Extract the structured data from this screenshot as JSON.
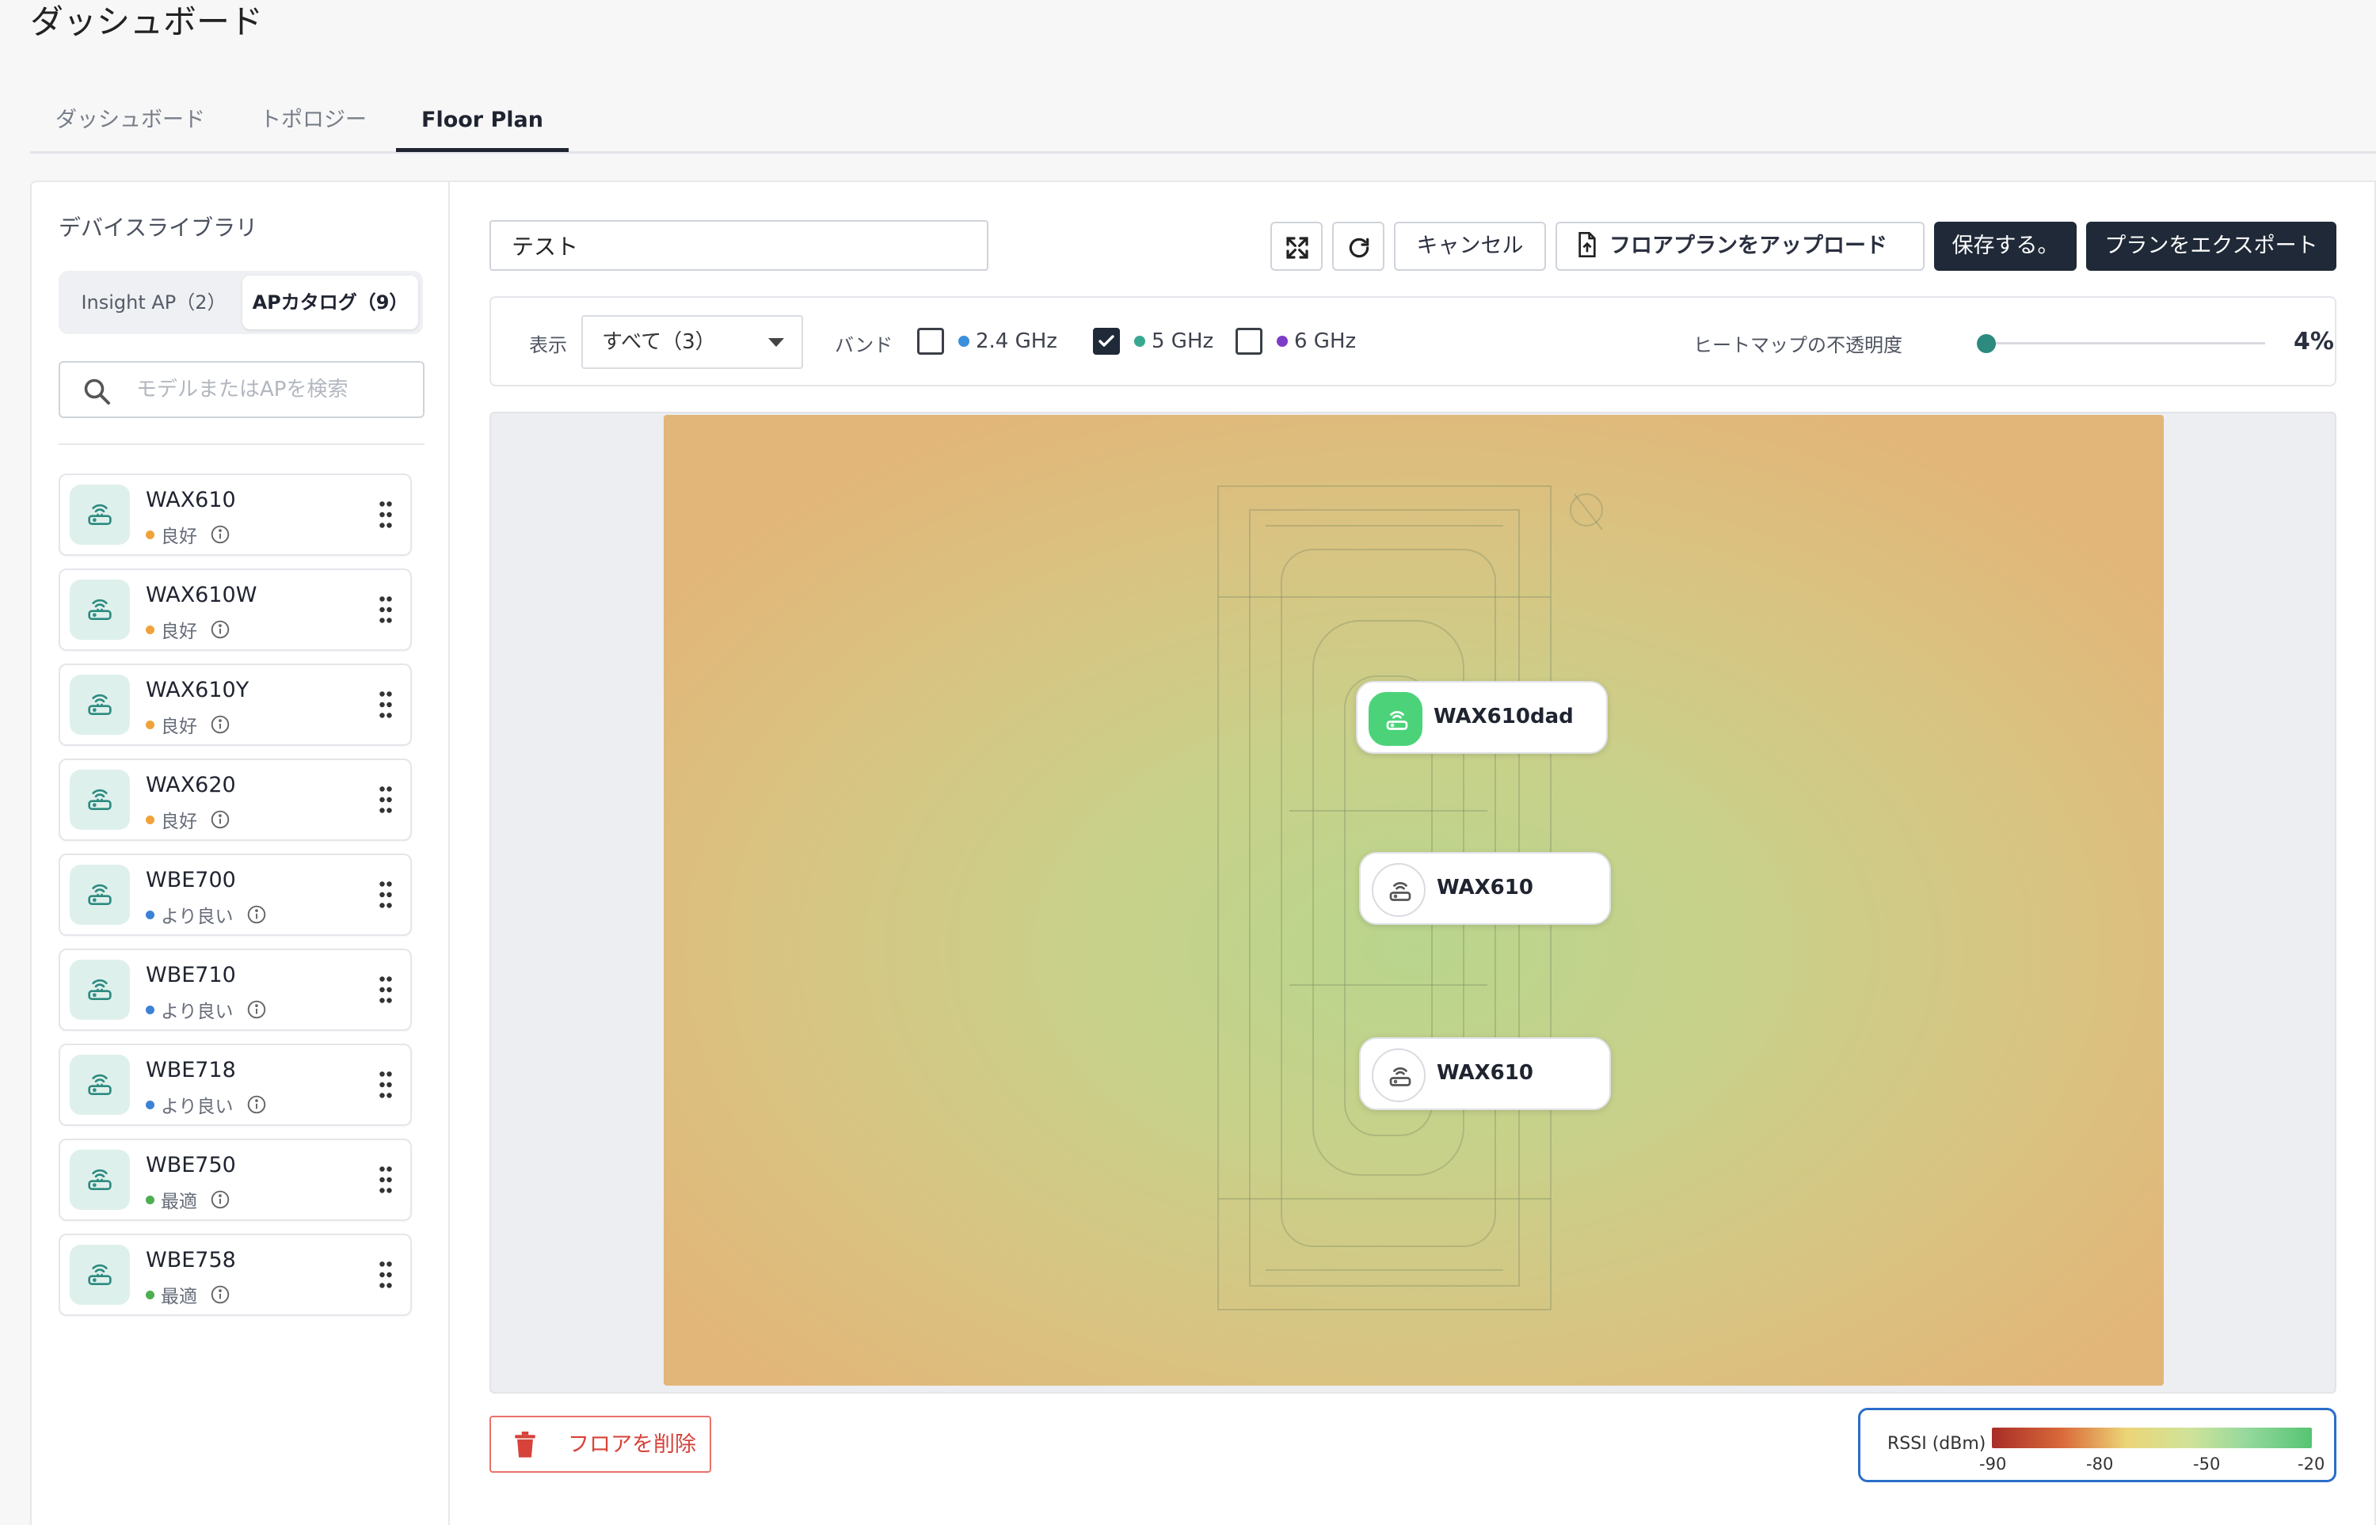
{
  "page": {
    "title": "ダッシュボード"
  },
  "tabs": [
    {
      "label": "ダッシュボード",
      "active": false
    },
    {
      "label": "トポロジー",
      "active": false
    },
    {
      "label": "Floor Plan",
      "active": true
    }
  ],
  "library": {
    "title": "デバイスライブラリ",
    "segments": [
      {
        "label": "Insight AP（2）",
        "active": false
      },
      {
        "label": "APカタログ（9）",
        "active": true
      }
    ],
    "search_placeholder": "モデルまたはAPを検索",
    "items": [
      {
        "name": "WAX610",
        "status": "良好",
        "status_color": "#f0a23a"
      },
      {
        "name": "WAX610W",
        "status": "良好",
        "status_color": "#f0a23a"
      },
      {
        "name": "WAX610Y",
        "status": "良好",
        "status_color": "#f0a23a"
      },
      {
        "name": "WAX620",
        "status": "良好",
        "status_color": "#f0a23a"
      },
      {
        "name": "WBE700",
        "status": "より良い",
        "status_color": "#3b82d6"
      },
      {
        "name": "WBE710",
        "status": "より良い",
        "status_color": "#3b82d6"
      },
      {
        "name": "WBE718",
        "status": "より良い",
        "status_color": "#3b82d6"
      },
      {
        "name": "WBE750",
        "status": "最適",
        "status_color": "#4caf50"
      },
      {
        "name": "WBE758",
        "status": "最適",
        "status_color": "#4caf50"
      }
    ]
  },
  "toolbar": {
    "floor_name": "テスト",
    "cancel": "キャンセル",
    "upload": "フロアプランをアップロード",
    "save": "保存する。",
    "export": "プランをエクスポート"
  },
  "filters": {
    "display_label": "表示",
    "display_value": "すべて（3）",
    "band_label": "バンド",
    "bands": [
      {
        "label": "2.4 GHz",
        "checked": false,
        "color": "#3b8fdc"
      },
      {
        "label": "5 GHz",
        "checked": true,
        "color": "#3aa890"
      },
      {
        "label": "6 GHz",
        "checked": false,
        "color": "#7d3cc8"
      }
    ],
    "opacity_label": "ヒートマップの不透明度",
    "opacity_value": "4%",
    "opacity_fraction": 0.04
  },
  "map": {
    "markers": [
      {
        "label": "WAX610dad",
        "highlighted": true
      },
      {
        "label": "WAX610",
        "highlighted": false
      },
      {
        "label": "WAX610",
        "highlighted": false
      }
    ]
  },
  "footer": {
    "delete": "フロアを削除",
    "legend_title": "RSSI (dBm)",
    "legend_ticks": [
      "-90",
      "-80",
      "-50",
      "-20"
    ]
  },
  "colors": {
    "accent_dark": "#1f2937",
    "teal": "#2c8a7f",
    "danger": "#d6433a",
    "legend_border": "#2b6dc9"
  }
}
